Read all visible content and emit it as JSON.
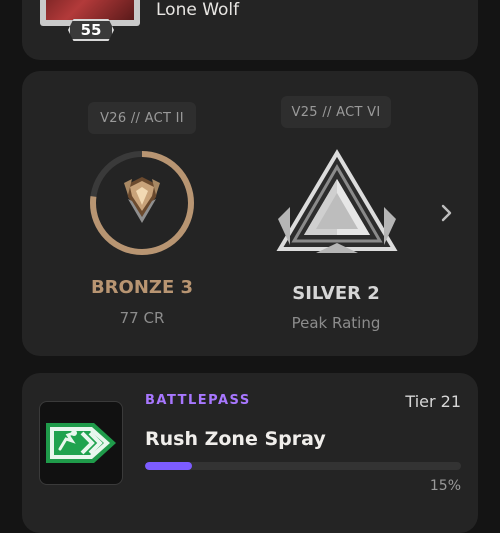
{
  "player": {
    "title": "Lone Wolf",
    "level": "55"
  },
  "rank": {
    "current": {
      "act": "V26 // ACT II",
      "name": "BRONZE 3",
      "sub": "77 CR",
      "progress": 0.77,
      "color": "#b89572"
    },
    "peak": {
      "act": "V25 // ACT VI",
      "name": "SILVER 2",
      "sub": "Peak Rating",
      "color": "#d6d6d6"
    },
    "next_icon": "chevron-right-icon"
  },
  "battlepass": {
    "label": "BATTLEPASS",
    "tier": "Tier 21",
    "item": "Rush Zone Spray",
    "progress": 0.15,
    "percent_text": "15%",
    "accent": "#a877ff",
    "bar_color": "#7c5cff"
  }
}
